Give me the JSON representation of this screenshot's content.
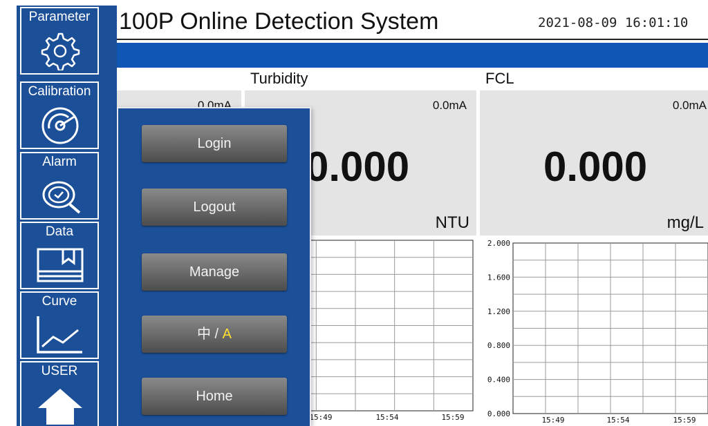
{
  "header": {
    "title": "100P Online Detection System",
    "datetime": "2021-08-09 16:01:10"
  },
  "sidebar": {
    "items": [
      {
        "label": "Parameter",
        "icon": "gear-icon"
      },
      {
        "label": "Calibration",
        "icon": "calibration-dial-icon"
      },
      {
        "label": "Alarm",
        "icon": "alarm-magnifier-icon"
      },
      {
        "label": "Data",
        "icon": "data-folder-icon"
      },
      {
        "label": "Curve",
        "icon": "curve-chart-icon"
      },
      {
        "label": "USER",
        "icon": "home-icon"
      }
    ]
  },
  "channels": [
    {
      "title": "",
      "current": "0.0mA",
      "value": "",
      "unit": ""
    },
    {
      "title": "Turbidity",
      "current": "0.0mA",
      "value": "0.000",
      "unit": "NTU"
    },
    {
      "title": "FCL",
      "current": "0.0mA",
      "value": "0.000",
      "unit": "mg/L"
    }
  ],
  "popup": {
    "buttons": [
      {
        "label": "Login"
      },
      {
        "label": "Logout"
      },
      {
        "label": "Manage"
      },
      {
        "label": "中 / ",
        "accent": "A"
      },
      {
        "label": "Home"
      }
    ],
    "accent_color": "#ffe033"
  },
  "chart_data": [
    {
      "type": "line",
      "x": [
        "15:49",
        "15:54",
        "15:59"
      ],
      "series": [],
      "grid": true
    },
    {
      "type": "line",
      "x": [
        "15:49",
        "15:54",
        "15:59"
      ],
      "yticks": [
        "2.000",
        "1.600",
        "1.200",
        "0.800",
        "0.400",
        "0.000"
      ],
      "ylim": [
        0,
        2
      ],
      "series": [],
      "grid": true
    }
  ],
  "colors": {
    "sidebar": "#1b4f98",
    "blue_bar": "#0f56b5",
    "panel": "#e4e4e4"
  }
}
